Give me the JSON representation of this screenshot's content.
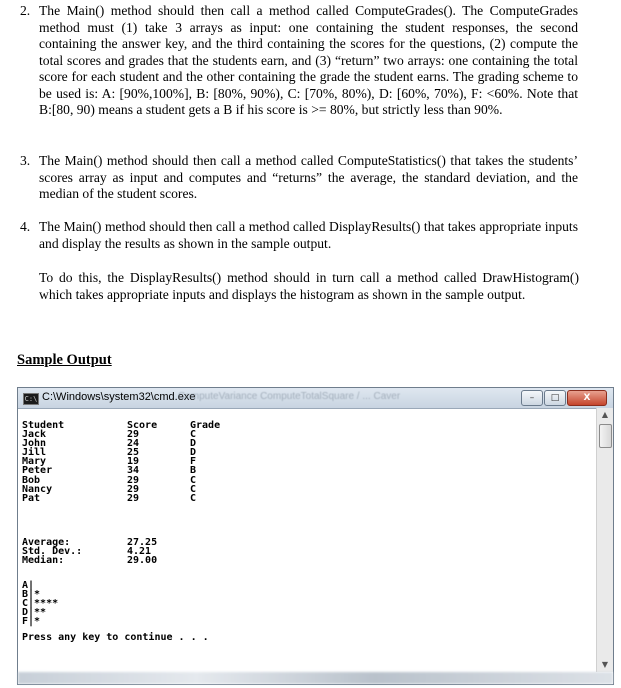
{
  "items": [
    {
      "number": "2.",
      "text": "The Main() method should then call a method called ComputeGrades(). The ComputeGrades method must (1) take 3 arrays as input: one containing the student responses, the second containing the answer key, and the third containing the scores for the questions, (2) compute the total scores and grades that the students earn, and (3) “return” two arrays: one containing the total score for each student and the other containing the grade the student earns. The grading scheme to be used is: A: [90%,100%], B: [80%, 90%), C: [70%, 80%), D: [60%, 70%), F: <60%. Note that B:[80, 90) means a student gets a B if his score is >= 80%, but strictly less than 90%."
    },
    {
      "number": "3.",
      "text": "The Main() method should then call a method called ComputeStatistics() that takes the students’ scores array as input and computes and “returns” the average, the standard deviation, and the median of the student scores."
    },
    {
      "number": "4.",
      "text": "The Main() method should then call a method called DisplayResults() that takes appropriate inputs and display the results as shown in the sample output."
    }
  ],
  "paragraph": "To do this, the DisplayResults() method should in turn call a method called DrawHistogram() which takes appropriate inputs and displays the histogram as shown in the sample output.",
  "heading": "Sample Output",
  "window": {
    "title": "C:\\Windows\\system32\\cmd.exe",
    "ghost_title": "ComputeVariance  ComputeTotalSquare  /  ...  Caver",
    "icon_label": "C:\\",
    "minimize": "–",
    "maximize": "□",
    "close": "X",
    "scroll_up": "▲",
    "scroll_down": "▼"
  },
  "console": {
    "headers": {
      "student": "Student",
      "score": "Score",
      "grade": "Grade"
    },
    "students": [
      {
        "name": "Jack",
        "score": "29",
        "grade": "C"
      },
      {
        "name": "John",
        "score": "24",
        "grade": "D"
      },
      {
        "name": "Jill",
        "score": "25",
        "grade": "D"
      },
      {
        "name": "Mary",
        "score": "19",
        "grade": "F"
      },
      {
        "name": "Peter",
        "score": "34",
        "grade": "B"
      },
      {
        "name": "Bob",
        "score": "29",
        "grade": "C"
      },
      {
        "name": "Nancy",
        "score": "29",
        "grade": "C"
      },
      {
        "name": "Pat",
        "score": "29",
        "grade": "C"
      }
    ],
    "stats": [
      {
        "label": "Average:",
        "value": "27.25"
      },
      {
        "label": "Std. Dev.:",
        "value": "4.21"
      },
      {
        "label": "Median:",
        "value": "29.00"
      }
    ],
    "histogram": [
      "A|",
      "B|*",
      "C|****",
      "D|**",
      "F|*"
    ],
    "prompt": "Press any key to continue . . ."
  }
}
